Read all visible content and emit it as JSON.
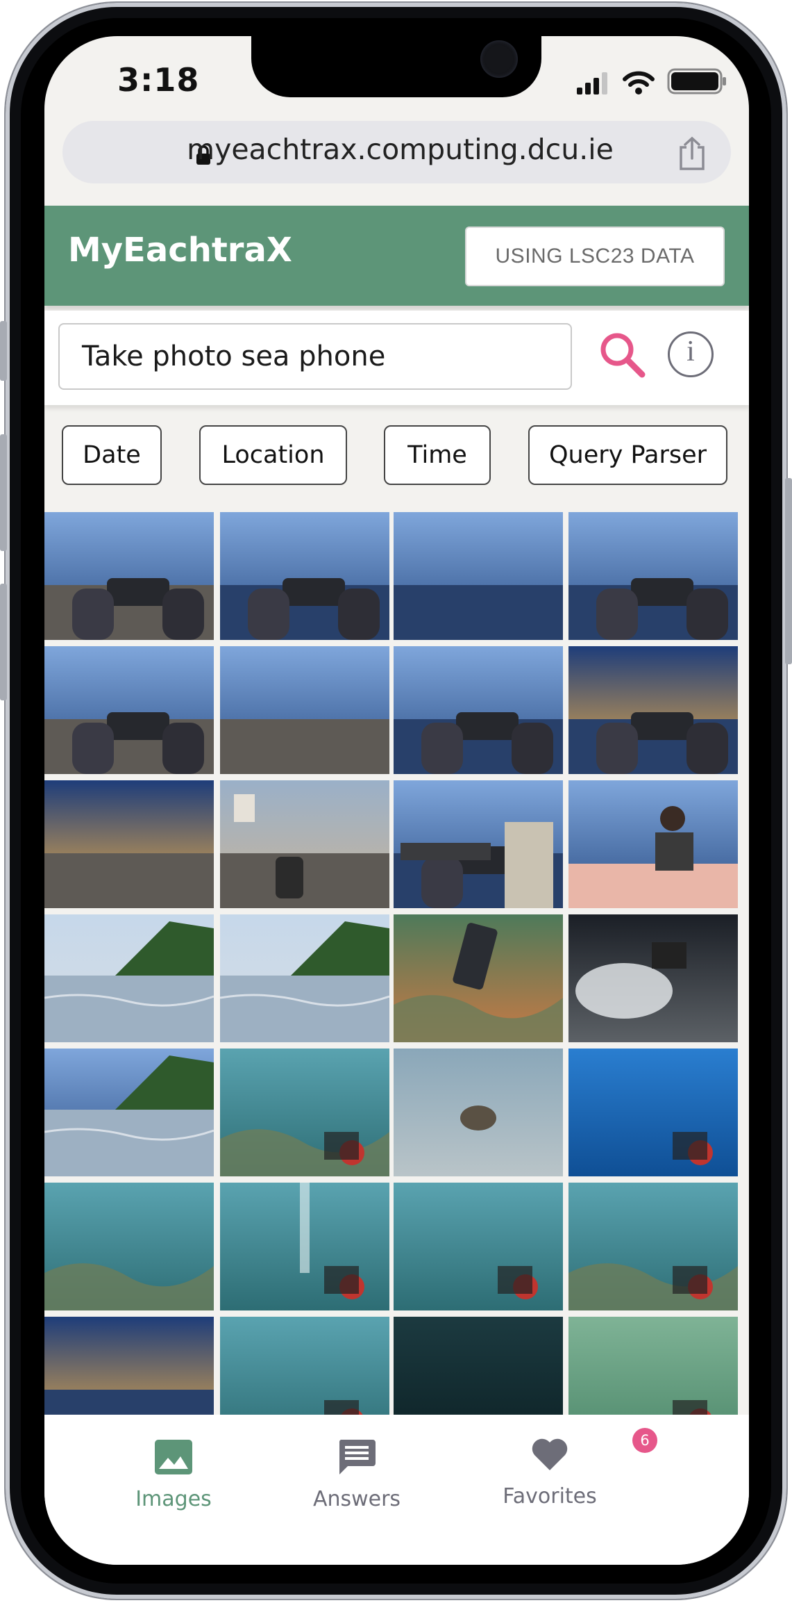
{
  "status_bar": {
    "time": "3:18"
  },
  "browser": {
    "url": "myeachtrax.computing.dcu.ie"
  },
  "app": {
    "brand": "MyEachtraX",
    "dataset_button": "USING LSC23 DATA"
  },
  "search": {
    "query": "Take photo sea phone"
  },
  "filters": [
    "Date",
    "Location",
    "Time",
    "Query Parser"
  ],
  "tabs": [
    {
      "label": "Images",
      "icon": "image-icon",
      "active": true
    },
    {
      "label": "Answers",
      "icon": "message-icon",
      "active": false
    },
    {
      "label": "Favorites",
      "icon": "heart-icon",
      "active": false
    }
  ],
  "favorites_count": "6",
  "colors": {
    "primary": "#5d9578",
    "search_icon": "#e6578a",
    "badge": "#e6578a",
    "inactive_tab": "#6d6d78"
  },
  "photo_scenes": [
    "beach-hand-phone",
    "phone-over-sea",
    "blue-sky-sea",
    "hand-phone-sky",
    "hands-phone-shore",
    "rocky-beach",
    "hands-phone-sea",
    "phone-sunset",
    "tidal-flat-dusk",
    "beach-people",
    "pier-person-phone",
    "person-on-boat",
    "water-level-island",
    "water-level-island-2",
    "underwater-phone",
    "underwater-light",
    "sea-surface-trees",
    "reef-camera",
    "sea-turtle",
    "blue-water-diver",
    "coral-seabed",
    "bubbles-diver",
    "diver-murky",
    "camera-rig-coral",
    "diver-dusk",
    "underwater-camera-light",
    "dark-water",
    "green-water-diver"
  ]
}
